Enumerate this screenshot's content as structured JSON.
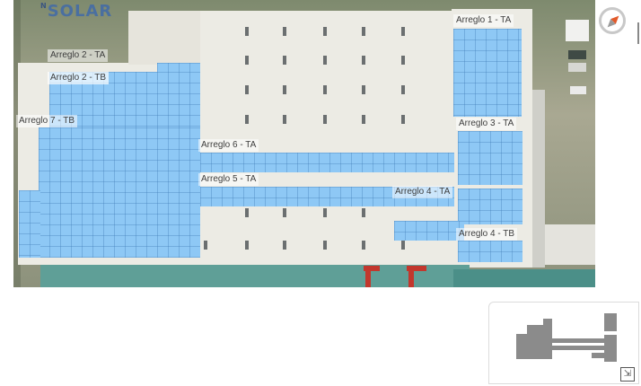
{
  "logo": {
    "prefix": "N",
    "text": "SOLAR"
  },
  "arrays": [
    {
      "label": "Arreglo 1 - TA"
    },
    {
      "label": "Arreglo 2 - TA"
    },
    {
      "label": "Arreglo 2 - TB"
    },
    {
      "label": "Arreglo 7 - TB"
    },
    {
      "label": "Arreglo 3 - TA"
    },
    {
      "label": "Arreglo 6 - TA"
    },
    {
      "label": "Arreglo 5 - TA"
    },
    {
      "label": "Arreglo 4 - TA"
    },
    {
      "label": "Arreglo 4 - TB"
    }
  ],
  "compass": {
    "icon": "compass-icon"
  },
  "minimap": {
    "expand_icon": "expand-icon",
    "expand_glyph": "⇲"
  },
  "colors": {
    "panel": "#8ec8f5",
    "roof": "#ecebe4",
    "compass_needle": "#e25a2b"
  }
}
